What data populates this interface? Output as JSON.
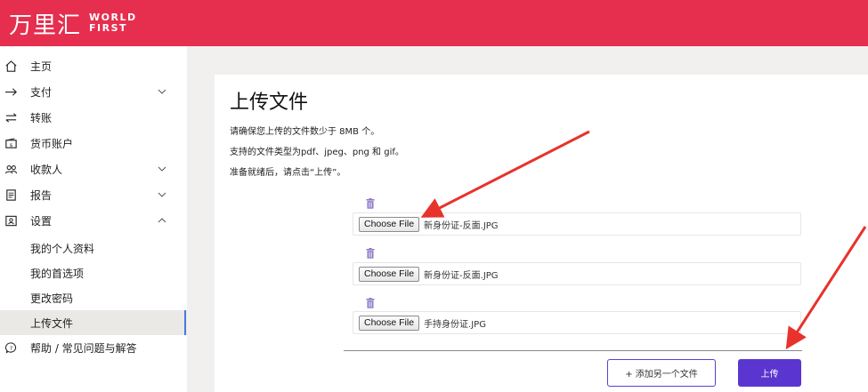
{
  "header": {
    "logo_cn": "万里汇",
    "logo_en_line1": "WORLD",
    "logo_en_line2": "FIRST",
    "brand_color": "#e62e4f"
  },
  "sidebar": {
    "items": [
      {
        "label": "主页",
        "icon": "home-icon"
      },
      {
        "label": "支付",
        "icon": "arrow-right-icon"
      },
      {
        "label": "转账",
        "icon": "transfer-icon"
      },
      {
        "label": "货币账户",
        "icon": "wallet-icon"
      },
      {
        "label": "收款人",
        "icon": "users-icon"
      },
      {
        "label": "报告",
        "icon": "document-icon"
      },
      {
        "label": "设置",
        "icon": "id-card-icon"
      },
      {
        "label": "帮助 / 常见问题与解答",
        "icon": "chat-help-icon"
      }
    ],
    "settings_sub": [
      {
        "label": "我的个人资料"
      },
      {
        "label": "我的首选项"
      },
      {
        "label": "更改密码"
      },
      {
        "label": "上传文件",
        "active": true
      }
    ]
  },
  "main": {
    "title": "上传文件",
    "instructions": [
      "请确保您上传的文件数少于 8MB 个。",
      "支持的文件类型为pdf、jpeg、png 和 gif。",
      "准备就绪后，请点击“上传”。"
    ],
    "files": [
      {
        "button_label": "Choose File",
        "file_name": "新身份证-反面.JPG"
      },
      {
        "button_label": "Choose File",
        "file_name": "新身份证-反面.JPG"
      },
      {
        "button_label": "Choose File",
        "file_name": "手持身份证.JPG"
      }
    ],
    "add_button_label": "+ 添加另一个文件",
    "upload_button_label": "上传",
    "accent_color": "#5b35d0"
  }
}
